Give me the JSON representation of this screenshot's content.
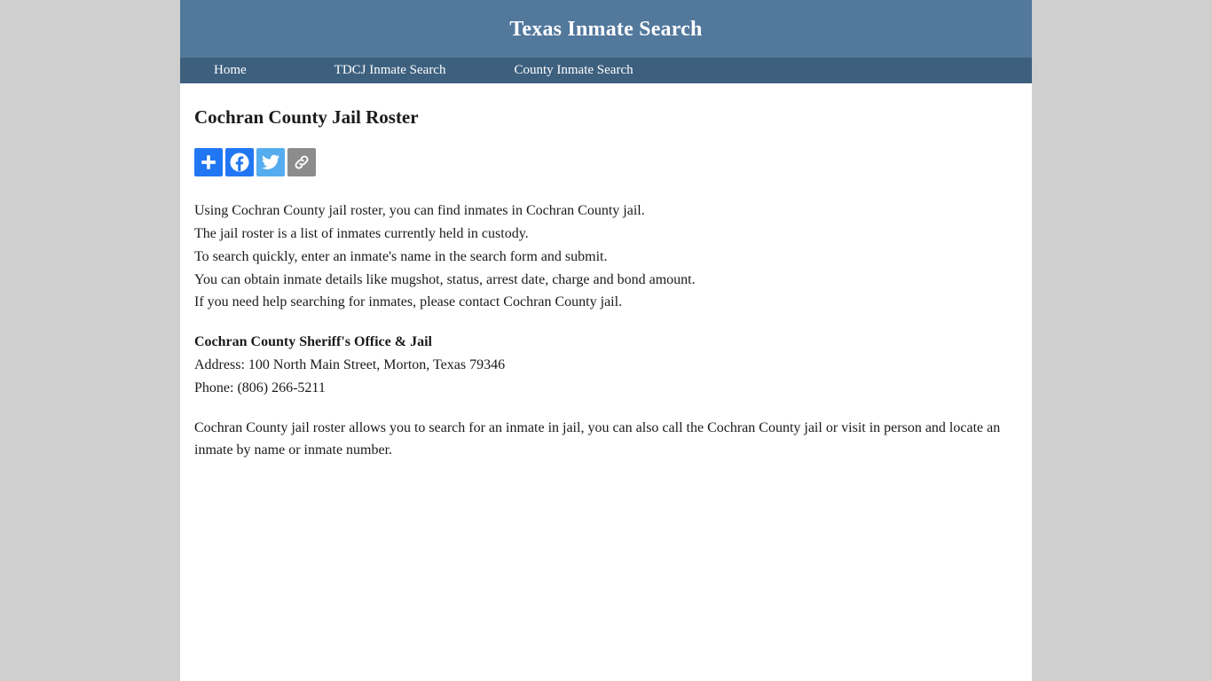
{
  "header": {
    "site_title": "Texas Inmate Search",
    "bg_color": "#52789c"
  },
  "nav": {
    "bg_color": "#3d607f",
    "items": [
      {
        "label": "Home",
        "name": "home"
      },
      {
        "label": "TDCJ Inmate Search",
        "name": "tdcj-inmate-search"
      },
      {
        "label": "County Inmate Search",
        "name": "county-inmate-search"
      }
    ]
  },
  "main": {
    "page_heading": "Cochran County Jail Roster",
    "share": {
      "buttons": [
        {
          "name": "addthis-share-button",
          "label": "Share",
          "icon": "plus-icon",
          "color": "#2176f3"
        },
        {
          "name": "facebook-share-button",
          "label": "Facebook",
          "icon": "facebook-icon",
          "color": "#2176f3"
        },
        {
          "name": "twitter-share-button",
          "label": "Twitter",
          "icon": "twitter-icon",
          "color": "#55acee"
        },
        {
          "name": "copy-link-share-button",
          "label": "Copy Link",
          "icon": "link-icon",
          "color": "#8c8c8c"
        }
      ]
    },
    "intro_lines": [
      "Using Cochran County jail roster, you can find inmates in Cochran County jail.",
      "The jail roster is a list of inmates currently held in custody.",
      "To search quickly, enter an inmate's name in the search form and submit.",
      "You can obtain inmate details like mugshot, status, arrest date, charge and bond amount.",
      "If you need help searching for inmates, please contact Cochran County jail."
    ],
    "office": {
      "name": "Cochran County Sheriff's Office & Jail",
      "address": "Address: 100 North Main Street, Morton, Texas 79346",
      "phone": "Phone: (806) 266-5211"
    },
    "closing_paragraph": "Cochran County jail roster allows you to search for an inmate in jail, you can also call the Cochran County jail or visit in person and locate an inmate by name or inmate number."
  }
}
